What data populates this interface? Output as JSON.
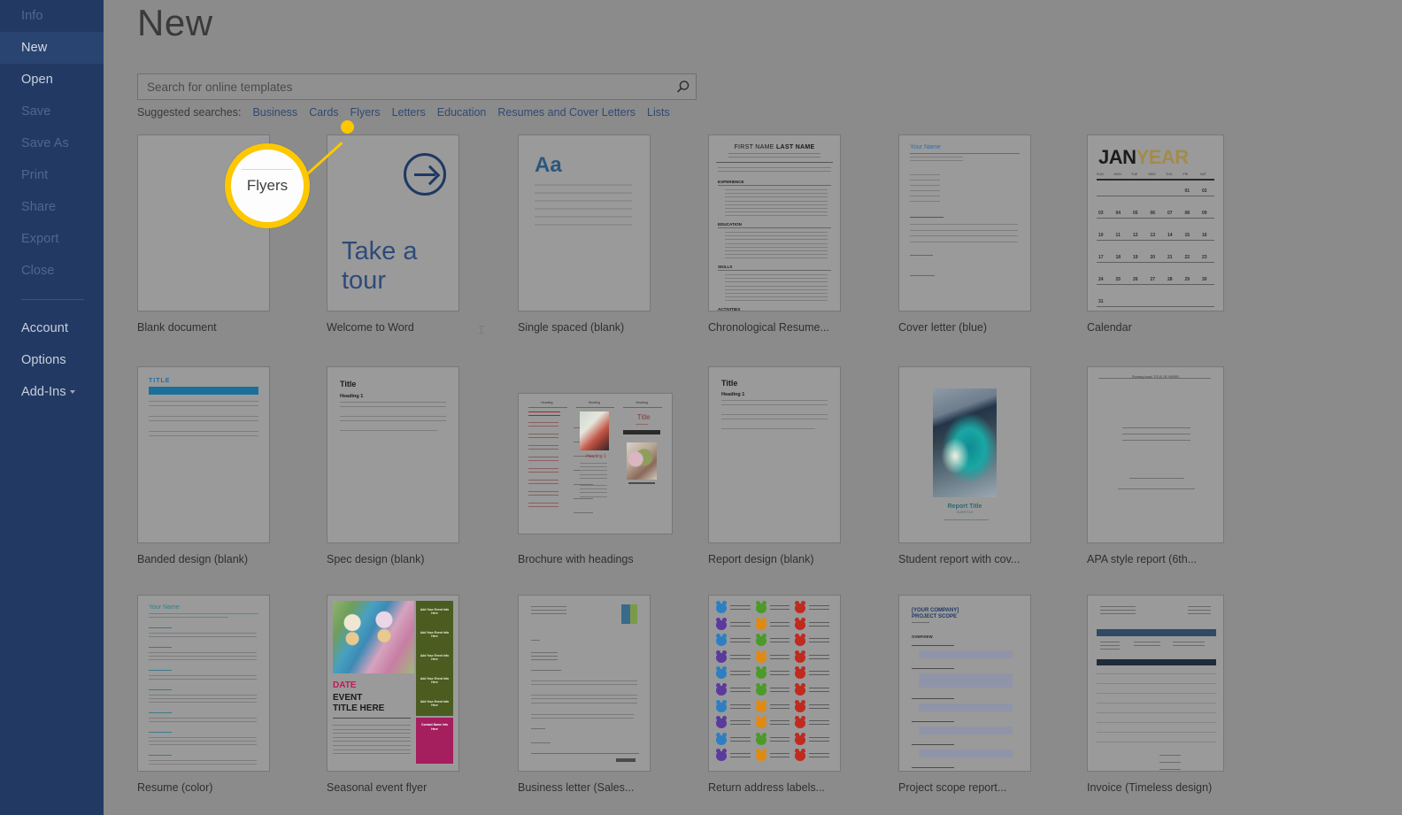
{
  "window": {
    "title": "New"
  },
  "sidebar": {
    "items": [
      {
        "label": "Info",
        "state": "dim"
      },
      {
        "label": "New",
        "state": "selected"
      },
      {
        "label": "Open",
        "state": "bright"
      },
      {
        "label": "Save",
        "state": "dim"
      },
      {
        "label": "Save As",
        "state": "dim"
      },
      {
        "label": "Print",
        "state": "dim"
      },
      {
        "label": "Share",
        "state": "dim"
      },
      {
        "label": "Export",
        "state": "dim"
      },
      {
        "label": "Close",
        "state": "dim"
      }
    ],
    "bottom_items": [
      {
        "label": "Account",
        "state": "bright",
        "caret": false
      },
      {
        "label": "Options",
        "state": "bright",
        "caret": false
      },
      {
        "label": "Add-Ins",
        "state": "bright",
        "caret": true
      }
    ]
  },
  "search": {
    "placeholder": "Search for online templates",
    "value": "",
    "icon": "search-icon"
  },
  "suggested": {
    "label": "Suggested searches:",
    "links": [
      "Business",
      "Cards",
      "Flyers",
      "Letters",
      "Education",
      "Resumes and Cover Letters",
      "Lists"
    ]
  },
  "callout": {
    "magnified_text": "Flyers",
    "ring_color": "#fdc800",
    "dot_color": "#fcc800",
    "target_link": "Flyers"
  },
  "templates": {
    "rows": [
      [
        {
          "name": "Blank document",
          "art": "blank"
        },
        {
          "name": "Welcome to Word",
          "art": "welcome",
          "headline": "Take a\ntour"
        },
        {
          "name": "Single spaced (blank)",
          "art": "single-spaced",
          "sample": "Aa"
        },
        {
          "name": "Chronological Resume...",
          "art": "chrono-resume",
          "heading_a": "FIRST NAME",
          "heading_b": "LAST NAME",
          "sections": [
            "EXPERIENCE",
            "EDUCATION",
            "SKILLS",
            "ACTIVITIES"
          ]
        },
        {
          "name": "Cover letter (blue)",
          "art": "cover-letter",
          "heading": "Your Name"
        },
        {
          "name": "Calendar",
          "art": "calendar",
          "month": "JAN",
          "year": "YEAR"
        }
      ],
      [
        {
          "name": "Banded design (blank)",
          "art": "banded",
          "title": "TITLE"
        },
        {
          "name": "Spec design (blank)",
          "art": "spec",
          "title": "Title",
          "heading": "Heading 1"
        },
        {
          "name": "Brochure with headings",
          "art": "brochure",
          "panel_title": "Title"
        },
        {
          "name": "Report design (blank)",
          "art": "report",
          "title": "Title",
          "heading": "Heading 1"
        },
        {
          "name": "Student report with cov...",
          "art": "student-report",
          "title": "Report Title",
          "subtitle": "SUBTITLE"
        },
        {
          "name": "APA style report (6th...",
          "art": "apa-report"
        }
      ],
      [
        {
          "name": "Resume (color)",
          "art": "resume-color",
          "heading": "Your Name"
        },
        {
          "name": "Seasonal event flyer",
          "art": "seasonal-flyer",
          "date": "DATE",
          "line1": "EVENT",
          "line2": "TITLE HERE"
        },
        {
          "name": "Business letter (Sales...",
          "art": "business-letter"
        },
        {
          "name": "Return address labels...",
          "art": "address-labels",
          "icon_colors": [
            [
              "#2e7fc1",
              "#4c9a2a",
              "#c02a1f"
            ],
            [
              "#5b3a9e",
              "#e08a12",
              "#c02a1f"
            ],
            [
              "#2e7fc1",
              "#4c9a2a",
              "#c02a1f"
            ],
            [
              "#5b3a9e",
              "#e08a12",
              "#c02a1f"
            ],
            [
              "#2e7fc1",
              "#4c9a2a",
              "#c02a1f"
            ],
            [
              "#5b3a9e",
              "#4c9a2a",
              "#c02a1f"
            ],
            [
              "#2e7fc1",
              "#e08a12",
              "#c02a1f"
            ],
            [
              "#5b3a9e",
              "#e08a12",
              "#c02a1f"
            ],
            [
              "#2e7fc1",
              "#4c9a2a",
              "#c02a1f"
            ],
            [
              "#5b3a9e",
              "#e08a12",
              "#c02a1f"
            ]
          ]
        },
        {
          "name": "Project scope report...",
          "art": "project-scope",
          "title": "[YOUR COMPANY]\nPROJECT SCOPE",
          "section": "OVERVIEW"
        },
        {
          "name": "Invoice (Timeless design)",
          "art": "invoice"
        }
      ]
    ]
  },
  "colors": {
    "sidebar_bg": "#223a63",
    "sidebar_selected": "#2a4471",
    "page_bg": "#8b8b8b",
    "thumb_bg": "#9a9a9a",
    "accent_yellow": "#fdc800",
    "word_blue": "#1f3864"
  }
}
